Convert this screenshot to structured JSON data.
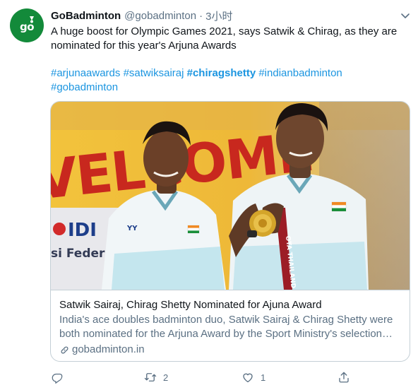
{
  "tweet": {
    "display_name": "GoBadminton",
    "handle": "@gobadminton",
    "separator": "·",
    "time": "3小时",
    "text": "A huge boost for Olympic Games 2021, says Satwik & Chirag, as they are nominated for this year's Arjuna Awards",
    "hashtags": [
      "#arjunaawards",
      "#satwiksairaj",
      "#chiragshetty",
      "#indianbadminton",
      "#gobadminton"
    ],
    "avatar_text": "go",
    "avatar_color": "#138a3a"
  },
  "card": {
    "title": "Satwik Sairaj, Chirag Shetty Nominated for Ajuna Award",
    "description": "India's ace doubles badminton duo, Satwik Sairaj & Chirag Shetty were both nominated for the Arjuna Award by the Sport Ministry's selection committee.",
    "domain": "gobadminton.in",
    "image": {
      "banner_text": "VELCOME",
      "sponsor_text": "IDI",
      "side_text": "si Feder",
      "ribbon_text": "OTA THAILAND"
    }
  },
  "actions": {
    "reply": {
      "icon": "reply-icon",
      "count": ""
    },
    "retweet": {
      "icon": "retweet-icon",
      "count": "2"
    },
    "like": {
      "icon": "heart-icon",
      "count": "1"
    },
    "share": {
      "icon": "share-icon",
      "count": ""
    }
  },
  "colors": {
    "link": "#1b95e0",
    "secondary_text": "#5b7083",
    "border": "#c4cfd6"
  }
}
